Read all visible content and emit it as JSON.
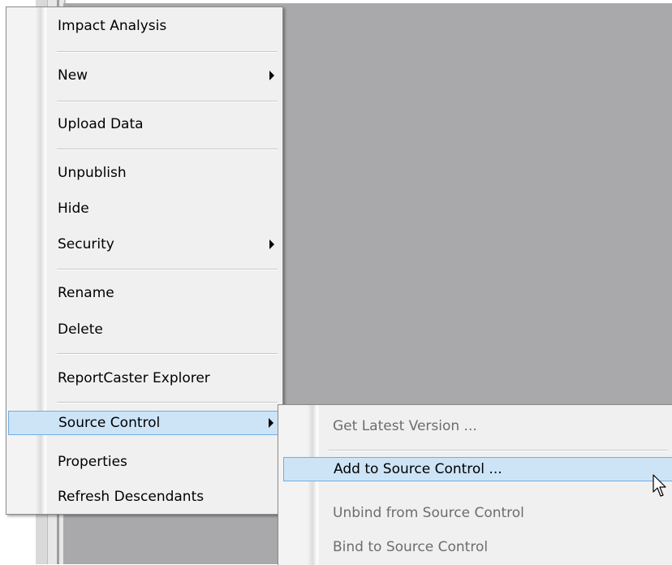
{
  "main_menu": {
    "items": [
      {
        "label": "Impact Analysis"
      },
      {
        "label": "New"
      },
      {
        "label": "Upload Data"
      },
      {
        "label": "Unpublish"
      },
      {
        "label": "Hide"
      },
      {
        "label": "Security"
      },
      {
        "label": "Rename"
      },
      {
        "label": "Delete"
      },
      {
        "label": "ReportCaster Explorer"
      },
      {
        "label": "Source Control"
      },
      {
        "label": "Properties"
      },
      {
        "label": "Refresh Descendants"
      }
    ]
  },
  "submenu": {
    "items": [
      {
        "label": "Get Latest Version ..."
      },
      {
        "label": "Add to Source Control ..."
      },
      {
        "label": "Unbind from Source Control"
      },
      {
        "label": "Bind to Source Control"
      }
    ]
  },
  "colors": {
    "highlight_fill": "#cde4f7",
    "highlight_border": "#6eaee6",
    "background_grey": "#a9a8aa"
  }
}
